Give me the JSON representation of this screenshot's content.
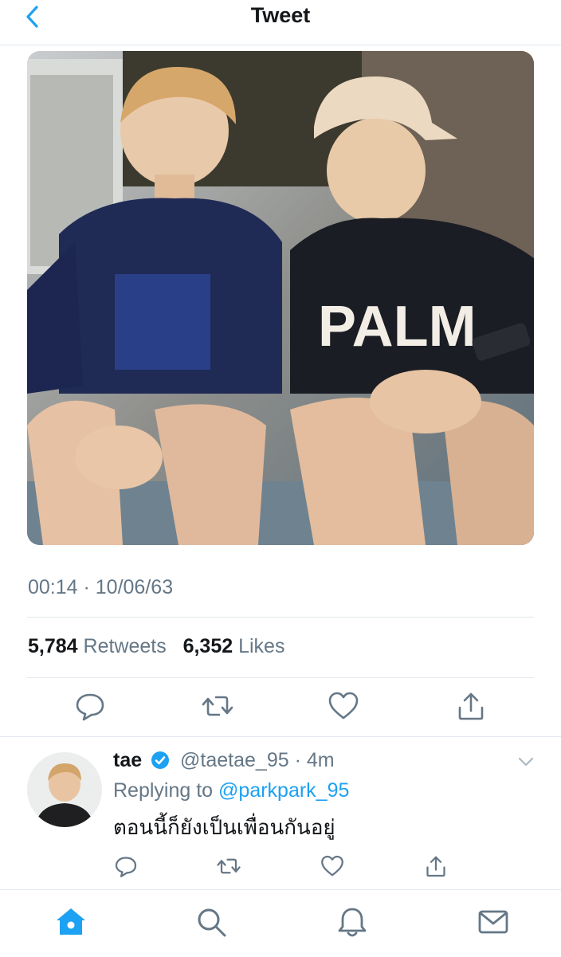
{
  "header": {
    "title": "Tweet",
    "back_icon": "chevron-left-icon"
  },
  "tweet": {
    "photo": "photo of two young men sitting on a step, one wearing a PALM t-shirt",
    "photo_shirt_text": "PALM",
    "timestamp": "00:14 · 10/06/63",
    "retweets_count": "5,784",
    "retweets_label": "Retweets",
    "likes_count": "6,352",
    "likes_label": "Likes",
    "actions": [
      "reply-icon",
      "retweet-icon",
      "like-icon",
      "share-icon"
    ]
  },
  "reply": {
    "name": "tae",
    "verified": true,
    "handle": "@taetae_95",
    "dot": "·",
    "time": "4m",
    "replying_prefix": "Replying to",
    "replying_to": "@parkpark_95",
    "text": "ตอนนี้ก็ยังเป็นเพื่อนกันอยู่",
    "actions": [
      "reply-icon",
      "retweet-icon",
      "like-icon",
      "share-icon"
    ]
  },
  "tabbar": {
    "items": [
      "home-icon",
      "search-icon",
      "notifications-icon",
      "messages-icon"
    ],
    "active": "home-icon"
  },
  "colors": {
    "accent": "#1da1f2",
    "secondary_text": "#657786",
    "divider": "#e1e8ed"
  }
}
